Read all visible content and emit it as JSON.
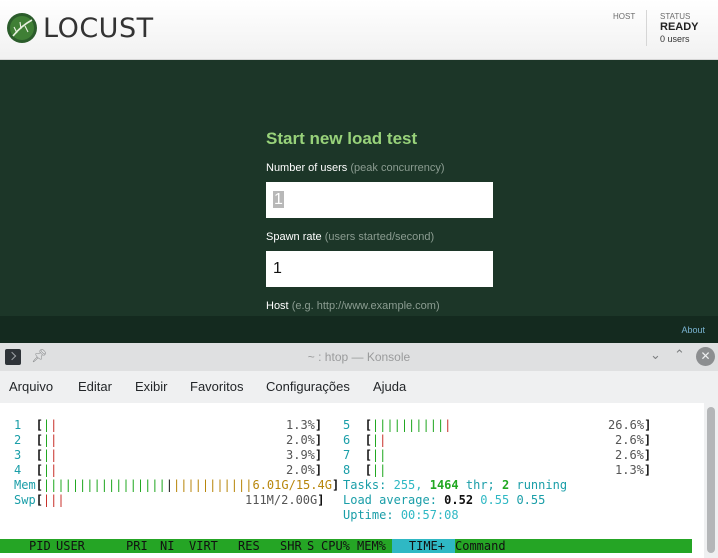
{
  "locust": {
    "app_title": "LOCUST",
    "header": {
      "host_label": "HOST",
      "status_label": "STATUS",
      "status_value": "READY",
      "users_text": "0 users"
    },
    "form": {
      "title": "Start new load test",
      "users_label": "Number of users",
      "users_hint": "(peak concurrency)",
      "users_value": "1",
      "spawn_label": "Spawn rate",
      "spawn_hint": "(users started/second)",
      "spawn_value": "1",
      "host_label": "Host",
      "host_hint": "(e.g. http://www.example.com)",
      "host_value": ""
    },
    "footer": {
      "about_link": "About"
    }
  },
  "konsole": {
    "window_title": "~ : htop — Konsole",
    "menu": [
      "Arquivo",
      "Editar",
      "Exibir",
      "Favoritos",
      "Configurações",
      "Ajuda"
    ],
    "cpus": [
      {
        "id": "1",
        "percent": "1.3%"
      },
      {
        "id": "2",
        "percent": "2.0%"
      },
      {
        "id": "3",
        "percent": "3.9%"
      },
      {
        "id": "4",
        "percent": "2.0%"
      },
      {
        "id": "5",
        "percent": "26.6%"
      },
      {
        "id": "6",
        "percent": "2.6%"
      },
      {
        "id": "7",
        "percent": "2.6%"
      },
      {
        "id": "8",
        "percent": "1.3%"
      }
    ],
    "mem": {
      "label": "Mem",
      "value": "6.01G/15.4G"
    },
    "swap": {
      "label": "Swp",
      "value": "111M/2.00G"
    },
    "tasks": {
      "label": "Tasks:",
      "count": "255,",
      "threads": "1464",
      "thr_label": "thr;",
      "running": "2",
      "running_label": "running"
    },
    "load": {
      "label": "Load average:",
      "v1": "0.52",
      "v5": "0.55",
      "v15": "0.55"
    },
    "uptime": {
      "label": "Uptime:",
      "value": "00:57:08"
    },
    "columns": [
      "PID",
      "USER",
      "PRI",
      "NI",
      "VIRT",
      "RES",
      "SHR",
      "S",
      "CPU%",
      "MEM%",
      "TIME+",
      "Command"
    ],
    "sorted_column": "TIME+"
  },
  "colors": {
    "locust_bg": "#1c3628",
    "locust_accent": "#98d27a",
    "htop_header_bar": "#25a525",
    "htop_sorted_column": "#2fb8c4"
  }
}
